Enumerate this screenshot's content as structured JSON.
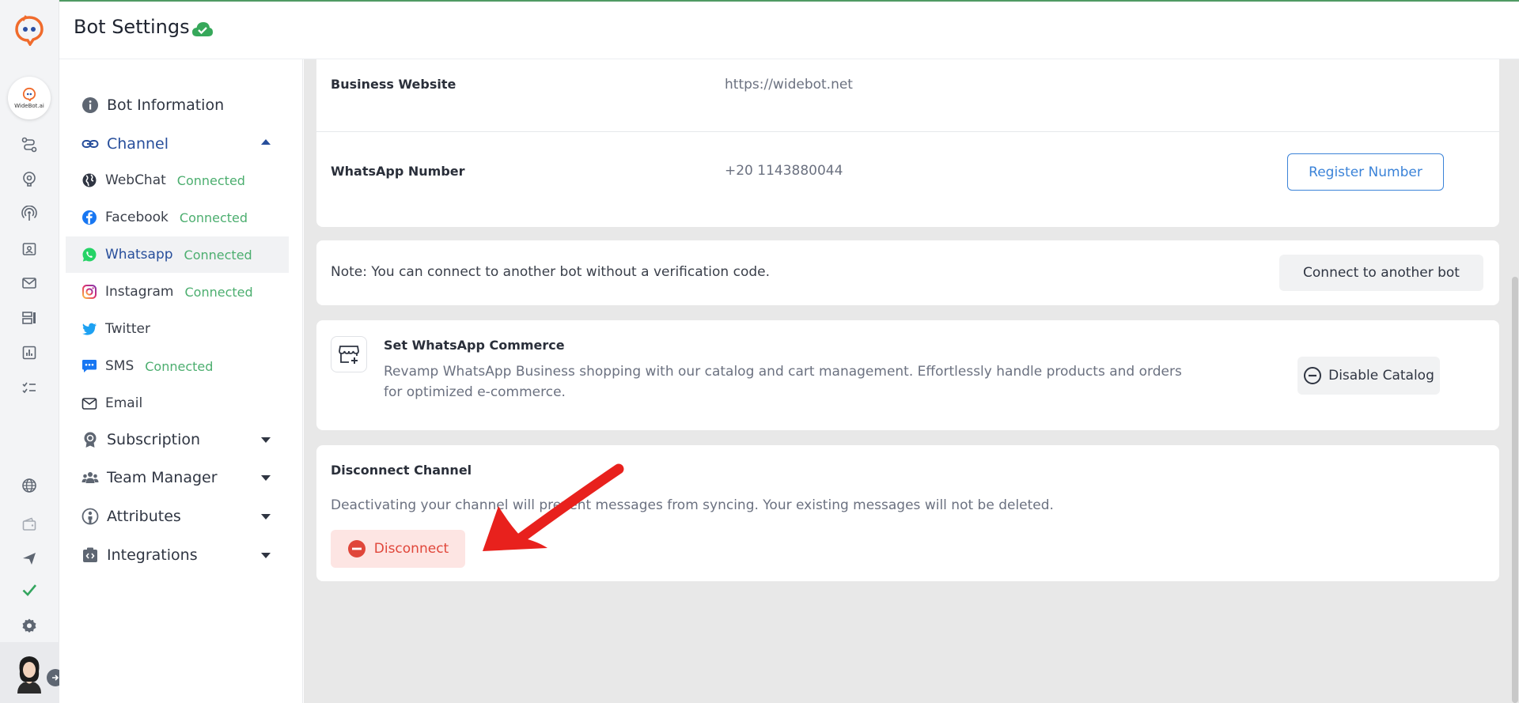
{
  "header": {
    "title": "Bot Settings"
  },
  "rail": {
    "bot_label": "WideBot.ai"
  },
  "sidebar": {
    "bot_information": "Bot Information",
    "channel": "Channel",
    "channels": [
      {
        "name": "WebChat",
        "status": "Connected"
      },
      {
        "name": "Facebook",
        "status": "Connected"
      },
      {
        "name": "Whatsapp",
        "status": "Connected"
      },
      {
        "name": "Instagram",
        "status": "Connected"
      },
      {
        "name": "Twitter",
        "status": ""
      },
      {
        "name": "SMS",
        "status": "Connected"
      },
      {
        "name": "Email",
        "status": ""
      }
    ],
    "subscription": "Subscription",
    "team_manager": "Team Manager",
    "attributes": "Attributes",
    "integrations": "Integrations"
  },
  "main": {
    "business_website_label": "Business Website",
    "business_website_value": "https://widebot.net",
    "whatsapp_number_label": "WhatsApp Number",
    "whatsapp_number_value": "+20 1143880044",
    "register_button": "Register Number",
    "note": "Note: You can connect to another bot without a verification code.",
    "connect_button": "Connect to another bot",
    "commerce_title": "Set WhatsApp Commerce",
    "commerce_desc": "Revamp WhatsApp Business shopping with our catalog and cart management. Effortlessly handle products and orders for optimized e-commerce.",
    "disable_catalog_button": "Disable Catalog",
    "disconnect_title": "Disconnect Channel",
    "disconnect_desc": "Deactivating your channel will prevent messages from syncing. Your existing messages will not be deleted.",
    "disconnect_button": "Disconnect"
  },
  "colors": {
    "accent": "#3b83d8",
    "connected": "#4cae6f",
    "danger": "#e0463a",
    "active": "#274e9b"
  }
}
